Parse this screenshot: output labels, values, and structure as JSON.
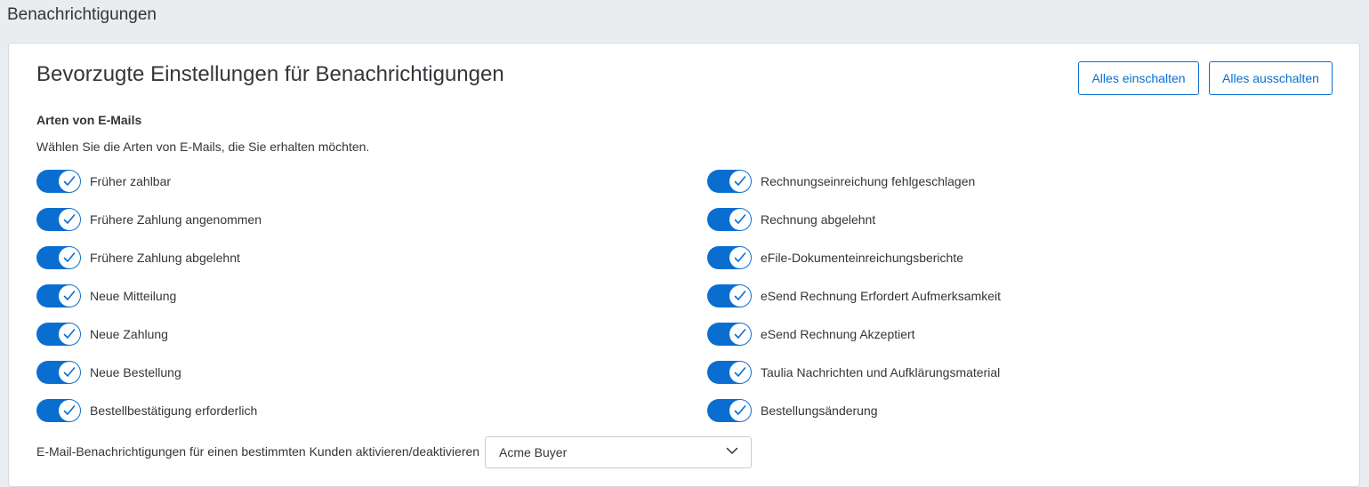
{
  "page": {
    "title": "Benachrichtigungen"
  },
  "card": {
    "title": "Bevorzugte Einstellungen für Benachrichtigungen",
    "buttons": {
      "enable_all": "Alles einschalten",
      "disable_all": "Alles ausschalten"
    },
    "section_label": "Arten von E-Mails",
    "section_description": "Wählen Sie die Arten von E-Mails, die Sie erhalten möchten."
  },
  "toggles_left": [
    {
      "label": "Früher zahlbar",
      "on": true
    },
    {
      "label": "Frühere Zahlung angenommen",
      "on": true
    },
    {
      "label": "Frühere Zahlung abgelehnt",
      "on": true
    },
    {
      "label": "Neue Mitteilung",
      "on": true
    },
    {
      "label": "Neue Zahlung",
      "on": true
    },
    {
      "label": "Neue Bestellung",
      "on": true
    },
    {
      "label": "Bestellbestätigung erforderlich",
      "on": true
    }
  ],
  "toggles_right": [
    {
      "label": "Rechnungseinreichung fehlgeschlagen",
      "on": true
    },
    {
      "label": "Rechnung abgelehnt",
      "on": true
    },
    {
      "label": "eFile-Dokumenteinreichungsberichte",
      "on": true
    },
    {
      "label": "eSend Rechnung Erfordert Aufmerksamkeit",
      "on": true
    },
    {
      "label": "eSend Rechnung Akzeptiert",
      "on": true
    },
    {
      "label": "Taulia Nachrichten und Aufklärungsmaterial",
      "on": true
    },
    {
      "label": "Bestellungsänderung",
      "on": true
    }
  ],
  "customer_filter": {
    "label": "E-Mail-Benachrichtigungen für einen bestimmten Kunden aktivieren/deaktivieren",
    "selected": "Acme Buyer"
  },
  "colors": {
    "accent": "#0a6ed1",
    "background": "#eaedef",
    "text": "#32363a"
  },
  "icons": {
    "toggle_knob": "checkmark-icon",
    "select_arrow": "chevron-down-icon"
  }
}
